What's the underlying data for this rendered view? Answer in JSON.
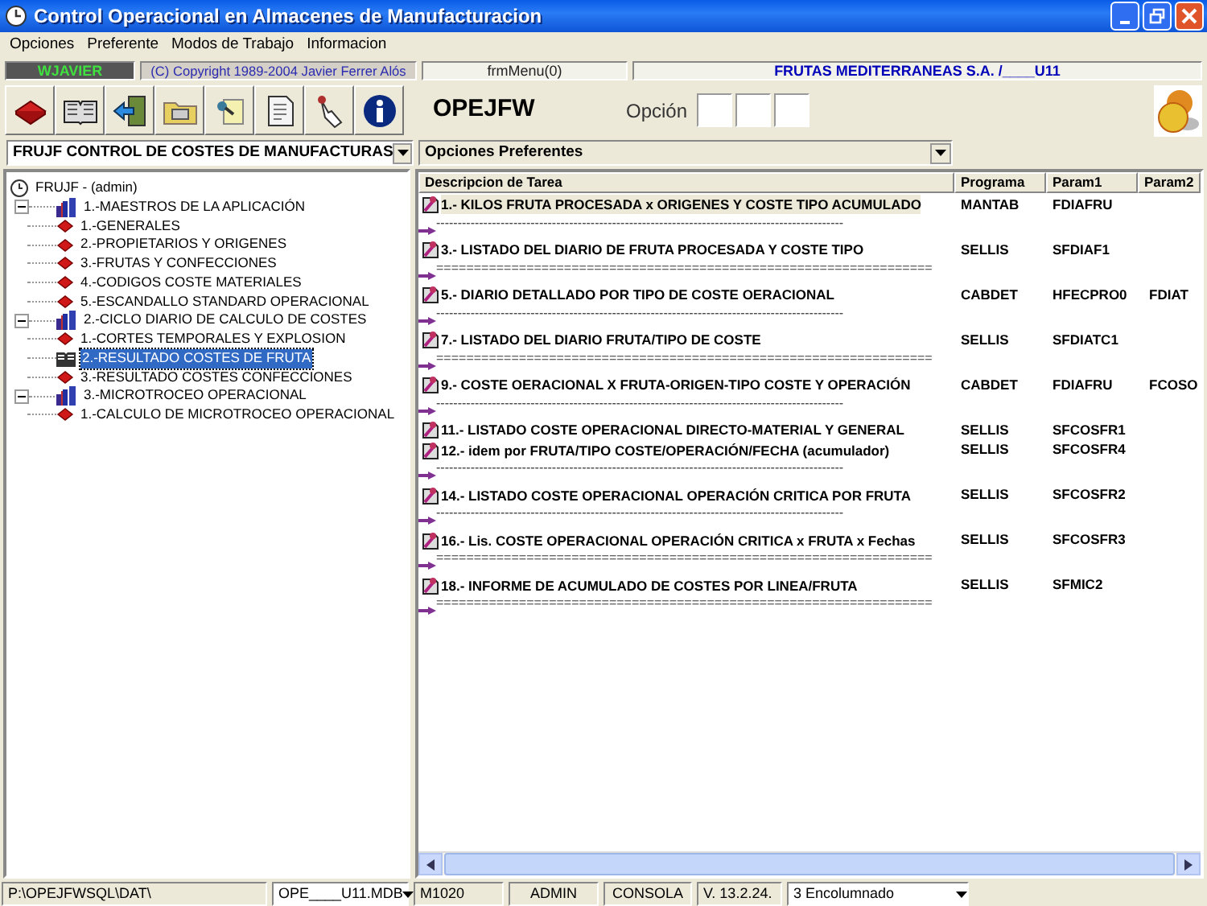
{
  "window": {
    "title": "Control Operacional en Almacenes de Manufacturacion"
  },
  "menu": [
    "Opciones",
    "Preferente",
    "Modos de Trabajo",
    "Informacion"
  ],
  "info_bar": {
    "user": "WJAVIER",
    "copyright": "(C) Copyright 1989-2004 Javier Ferrer Alós",
    "form": "frmMenu(0)",
    "company": "FRUTAS MEDITERRANEAS S.A. /____U11"
  },
  "toolbar": {
    "code": "OPEJFW",
    "option_label": "Opción"
  },
  "module_select": {
    "value": "FRUJF CONTROL DE COSTES DE MANUFACTURAS"
  },
  "preferences_select": {
    "value": "Opciones Preferentes"
  },
  "tree": {
    "label": "FRUJF - (admin)",
    "selected": false,
    "children": [
      {
        "label": "1.-MAESTROS DE LA APLICACIÓN",
        "expanded": true,
        "selected": false,
        "children": [
          {
            "label": "1.-GENERALES",
            "selected": false
          },
          {
            "label": "2.-PROPIETARIOS Y ORIGENES",
            "selected": false
          },
          {
            "label": "3.-FRUTAS Y CONFECCIONES",
            "selected": false
          },
          {
            "label": "4.-CODIGOS COSTE MATERIALES",
            "selected": false
          },
          {
            "label": "5.-ESCANDALLO STANDARD OPERACIONAL",
            "selected": false
          }
        ]
      },
      {
        "label": "2.-CICLO DIARIO DE CALCULO DE COSTES",
        "expanded": true,
        "selected": false,
        "children": [
          {
            "label": "1.-CORTES TEMPORALES Y EXPLOSION",
            "selected": false
          },
          {
            "label": "2.-RESULTADO COSTES DE FRUTA",
            "selected": true
          },
          {
            "label": "3.-RESULTADO COSTES CONFECCIONES",
            "selected": false
          }
        ]
      },
      {
        "label": "3.-MICROTROCEO OPERACIONAL",
        "expanded": true,
        "selected": false,
        "children": [
          {
            "label": "1.-CALCULO DE MICROTROCEO OPERACIONAL",
            "selected": false
          }
        ]
      }
    ]
  },
  "task_list": {
    "columns": [
      "Descripcion de Tarea",
      "Programa",
      "Param1",
      "Param2"
    ],
    "rows": [
      {
        "kind": "task",
        "description": "1.- KILOS FRUTA PROCESADA x ORIGENES Y COSTE TIPO ACUMULADO",
        "program": "MANTAB",
        "param1": "FDIAFRU",
        "selected": true
      },
      {
        "kind": "separator",
        "text": "-----------------------------------------------------------------------------------------------"
      },
      {
        "kind": "task",
        "description": "3.- LISTADO DEL DIARIO DE FRUTA PROCESADA Y COSTE TIPO",
        "program": "SELLIS",
        "param1": "SFDIAF1",
        "selected": false
      },
      {
        "kind": "separator",
        "text": "=================================================================="
      },
      {
        "kind": "task",
        "description": "5.- DIARIO DETALLADO POR TIPO DE COSTE OERACIONAL",
        "program": "CABDET",
        "param1": "HFECPRO0",
        "param2": "FDIAT",
        "selected": false
      },
      {
        "kind": "separator",
        "text": "-----------------------------------------------------------------------------------------------"
      },
      {
        "kind": "task",
        "description": "7.- LISTADO DEL DIARIO FRUTA/TIPO DE COSTE",
        "program": "SELLIS",
        "param1": "SFDIATC1",
        "selected": false
      },
      {
        "kind": "separator",
        "text": "=================================================================="
      },
      {
        "kind": "task",
        "description": "9.- COSTE OERACIONAL X FRUTA-ORIGEN-TIPO COSTE Y OPERACIÓN",
        "program": "CABDET",
        "param1": "FDIAFRU",
        "param2": "FCOSO",
        "selected": false
      },
      {
        "kind": "separator",
        "text": "-----------------------------------------------------------------------------------------------"
      },
      {
        "kind": "task",
        "description": "11.- LISTADO COSTE OPERACIONAL DIRECTO-MATERIAL Y GENERAL",
        "program": "SELLIS",
        "param1": "SFCOSFR1",
        "selected": false
      },
      {
        "kind": "task",
        "description": "12.- idem por FRUTA/TIPO COSTE/OPERACIÓN/FECHA (acumulador)",
        "program": "SELLIS",
        "param1": "SFCOSFR4",
        "selected": false
      },
      {
        "kind": "separator",
        "text": "-----------------------------------------------------------------------------------------------"
      },
      {
        "kind": "task",
        "description": "14.- LISTADO COSTE OPERACIONAL OPERACIÓN CRITICA POR FRUTA",
        "program": "SELLIS",
        "param1": "SFCOSFR2",
        "selected": false
      },
      {
        "kind": "separator",
        "text": "-----------------------------------------------------------------------------------------------"
      },
      {
        "kind": "task",
        "description": "16.- Lis. COSTE OPERACIONAL OPERACIÓN CRITICA x FRUTA x Fechas",
        "program": "SELLIS",
        "param1": "SFCOSFR3",
        "selected": false
      },
      {
        "kind": "separator",
        "text": "=================================================================="
      },
      {
        "kind": "task",
        "description": "18.- INFORME DE ACUMULADO DE COSTES POR LINEA/FRUTA",
        "program": "SELLIS",
        "param1": "SFMIC2",
        "selected": false
      },
      {
        "kind": "separator",
        "text": "=================================================================="
      }
    ]
  },
  "status_bar": {
    "path": "P:\\OPEJFWSQL\\DAT\\",
    "database": "OPE____U11.MDB",
    "code": "M1020",
    "user": "ADMIN",
    "mode": "CONSOLA",
    "version": "V. 13.2.24.",
    "layout": "3 Encolumnado"
  }
}
